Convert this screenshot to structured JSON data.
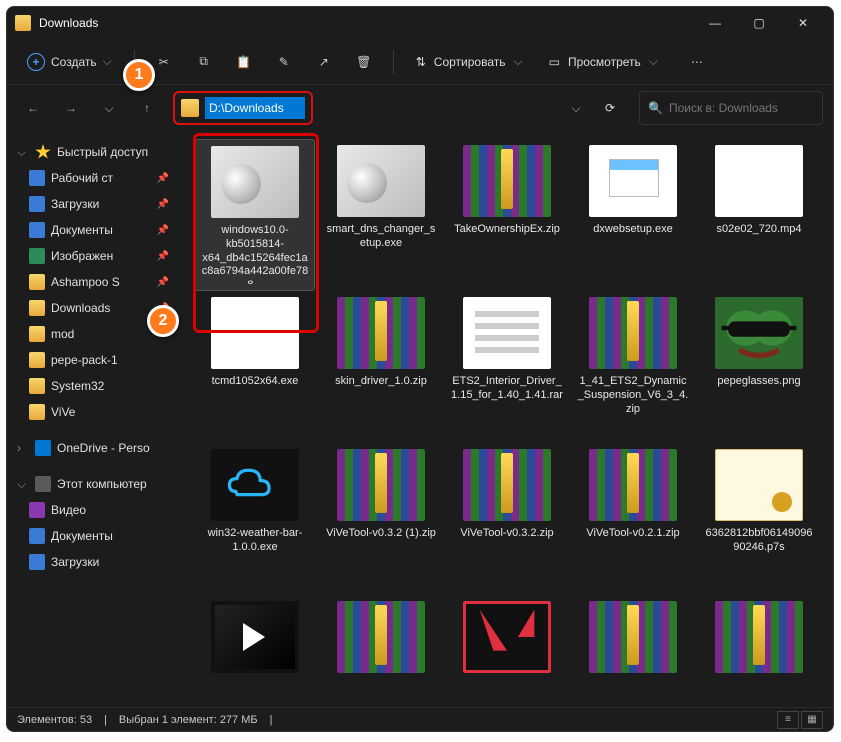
{
  "window": {
    "title": "Downloads"
  },
  "toolbar": {
    "new_label": "Создать",
    "sort_label": "Сортировать",
    "view_label": "Просмотреть"
  },
  "address": {
    "path": "D:\\Downloads"
  },
  "search": {
    "placeholder": "Поиск в: Downloads"
  },
  "sidebar": {
    "quick_access": "Быстрый доступ",
    "items": [
      {
        "label": "Рабочий ст",
        "icon": "side-blue",
        "pinned": true
      },
      {
        "label": "Загрузки",
        "icon": "side-dl",
        "pinned": true
      },
      {
        "label": "Документы",
        "icon": "side-blue",
        "pinned": true
      },
      {
        "label": "Изображен",
        "icon": "side-green",
        "pinned": true
      },
      {
        "label": "Ashampoo S",
        "icon": "side-folder",
        "pinned": true
      },
      {
        "label": "Downloads",
        "icon": "side-folder",
        "pinned": true
      },
      {
        "label": "mod",
        "icon": "side-folder",
        "pinned": false
      },
      {
        "label": "pepe-pack-1",
        "icon": "side-folder",
        "pinned": false
      },
      {
        "label": "System32",
        "icon": "side-folder",
        "pinned": false
      },
      {
        "label": "ViVe",
        "icon": "side-folder",
        "pinned": false
      }
    ],
    "onedrive": "OneDrive - Perso",
    "this_pc": "Этот компьютер",
    "pc_items": [
      {
        "label": "Видео",
        "icon": "side-video"
      },
      {
        "label": "Документы",
        "icon": "side-blue"
      },
      {
        "label": "Загрузки",
        "icon": "side-dl"
      }
    ]
  },
  "files": [
    {
      "name": "windows10.0-kb5015814-x64_db4c15264fec1ac8a6794a442a00fe788...",
      "icon": "ic-installer",
      "selected": true
    },
    {
      "name": "smart_dns_changer_setup.exe",
      "icon": "ic-installer"
    },
    {
      "name": "TakeOwnershipEx.zip",
      "icon": "ic-archive"
    },
    {
      "name": "dxwebsetup.exe",
      "icon": "ic-exe"
    },
    {
      "name": "s02e02_720.mp4",
      "icon": "ic-blankpage"
    },
    {
      "name": "tcmd1052x64.exe",
      "icon": "ic-blankpage"
    },
    {
      "name": "skin_driver_1.0.zip",
      "icon": "ic-archive"
    },
    {
      "name": "ETS2_Interior_Driver_1.15_for_1.40_1.41.rar",
      "icon": "ic-textpage"
    },
    {
      "name": "1_41_ETS2_Dynamic_Suspension_V6_3_4.zip",
      "icon": "ic-archive"
    },
    {
      "name": "pepeglasses.png",
      "icon": "ic-pepe"
    },
    {
      "name": "win32-weather-bar-1.0.0.exe",
      "icon": "ic-weather"
    },
    {
      "name": "ViVeTool-v0.3.2 (1).zip",
      "icon": "ic-archive"
    },
    {
      "name": "ViVeTool-v0.3.2.zip",
      "icon": "ic-archive"
    },
    {
      "name": "ViVeTool-v0.2.1.zip",
      "icon": "ic-archive"
    },
    {
      "name": "6362812bbf0614909690246.p7s",
      "icon": "ic-cert"
    },
    {
      "name": "",
      "icon": "ic-video"
    },
    {
      "name": "",
      "icon": "ic-archive"
    },
    {
      "name": "",
      "icon": "ic-valorant"
    },
    {
      "name": "",
      "icon": "ic-archive"
    },
    {
      "name": "",
      "icon": "ic-archive"
    }
  ],
  "status": {
    "items": "Элементов: 53",
    "selection": "Выбран 1 элемент: 277 МБ"
  },
  "callouts": {
    "one": "1",
    "two": "2"
  }
}
